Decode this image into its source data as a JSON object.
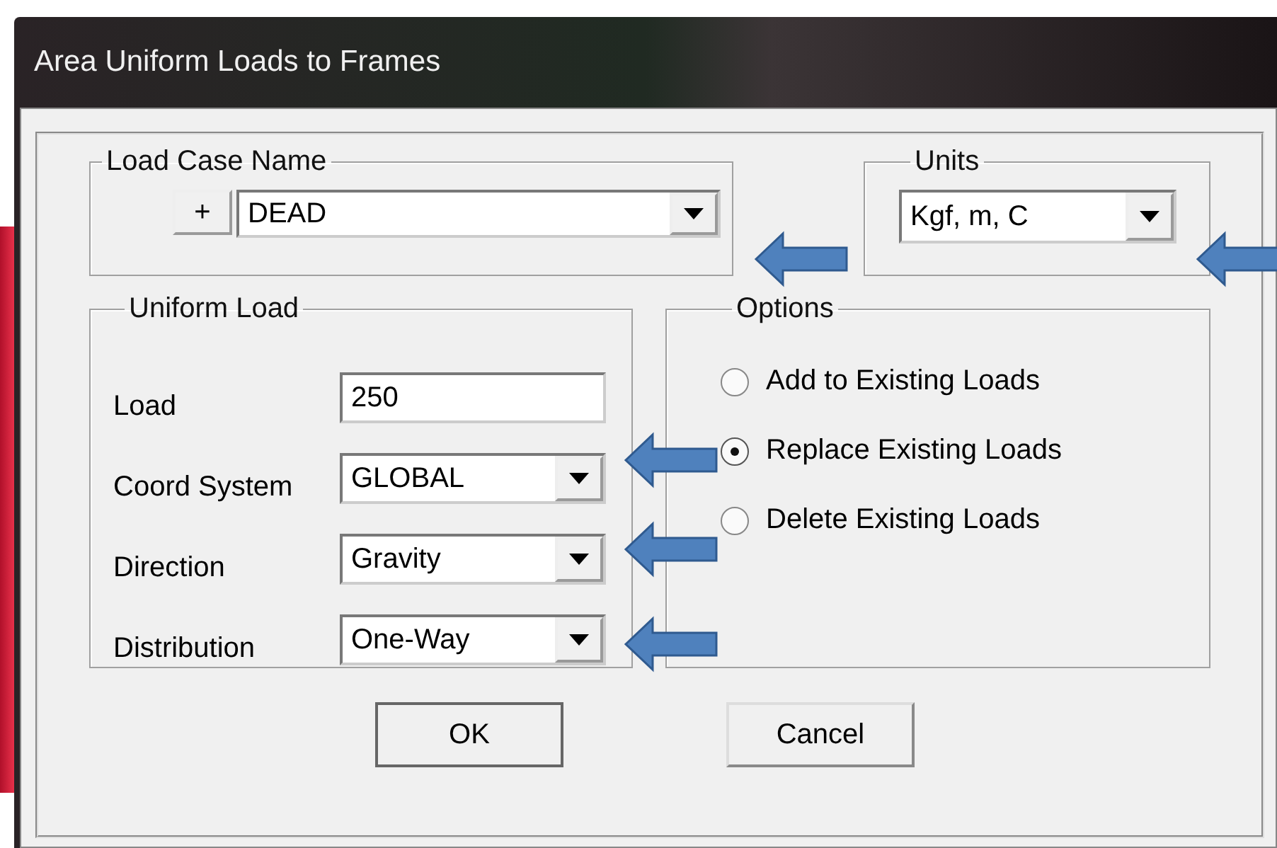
{
  "window": {
    "title": "Area Uniform Loads to Frames"
  },
  "load_case_name": {
    "label": "Load Case Name",
    "add_button": "+",
    "value": "DEAD"
  },
  "units": {
    "label": "Units",
    "value": "Kgf, m, C"
  },
  "uniform_load": {
    "label": "Uniform Load",
    "fields": [
      {
        "kind": "text",
        "label": "Load",
        "value": "250"
      },
      {
        "kind": "dropdown",
        "label": "Coord System",
        "value": "GLOBAL"
      },
      {
        "kind": "dropdown",
        "label": "Direction",
        "value": "Gravity"
      },
      {
        "kind": "dropdown",
        "label": "Distribution",
        "value": "One-Way"
      }
    ]
  },
  "options": {
    "label": "Options",
    "items": [
      {
        "label": "Add to Existing Loads",
        "selected": false
      },
      {
        "label": "Replace Existing Loads",
        "selected": true
      },
      {
        "label": "Delete Existing Loads",
        "selected": false
      }
    ]
  },
  "buttons": [
    {
      "label": "OK"
    },
    {
      "label": "Cancel"
    }
  ]
}
